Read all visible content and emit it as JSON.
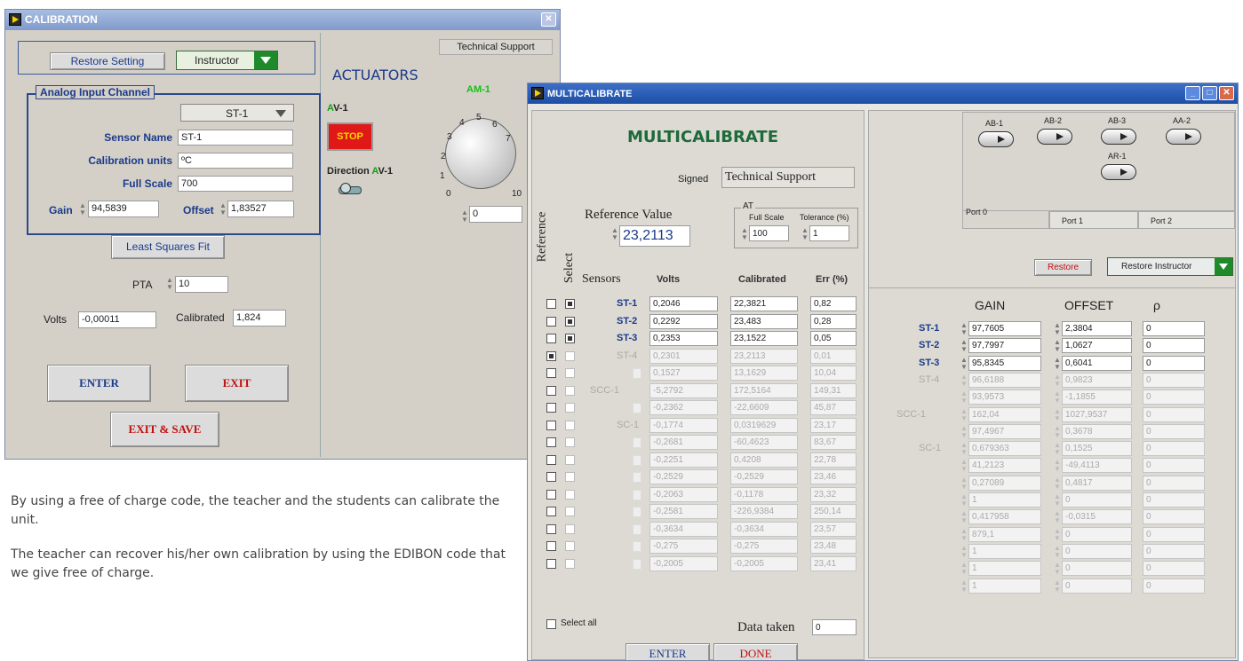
{
  "calibration": {
    "title": "CALIBRATION",
    "restore_setting": "Restore Setting",
    "user_select": "Instructor",
    "analog_group": "Analog Input Channel",
    "channel_select": "ST-1",
    "sensor_name_label": "Sensor Name",
    "sensor_name": "ST-1",
    "cal_units_label": "Calibration units",
    "cal_units": "ºC",
    "full_scale_label": "Full Scale",
    "full_scale": "700",
    "gain_label": "Gain",
    "gain": "94,5839",
    "offset_label": "Offset",
    "offset": "1,83527",
    "least_squares": "Least Squares Fit",
    "pta_label": "PTA",
    "pta": "10",
    "volts_label": "Volts",
    "volts": "-0,00011",
    "calibrated_label": "Calibrated",
    "calibrated": "1,824",
    "enter": "ENTER",
    "exit": "EXIT",
    "exit_save": "EXIT & SAVE",
    "tech_support": "Technical Support",
    "actuators": "ACTUATORS",
    "av_label_a": "A",
    "av_label_v": "V-1",
    "stop": "STOP",
    "direction_label": "Direction ",
    "direction_a": "A",
    "direction_v": "V-1",
    "am_label": "AM-1",
    "dial_ticks": [
      "0",
      "1",
      "2",
      "3",
      "4",
      "5",
      "6",
      "7",
      "10"
    ],
    "am_value": "0"
  },
  "description": {
    "p1": "By using a free of charge code, the teacher and the students can calibrate the unit.",
    "p2": "The teacher can recover his/her own calibration by using the EDIBON code that we give free of charge."
  },
  "multi": {
    "title": "MULTICALIBRATE",
    "heading": "MULTICALIBRATE",
    "signed_label": "Signed",
    "signed": "Technical Support",
    "reference_vert": "Reference",
    "select_vert": "Select",
    "ref_value_label": "Reference Value",
    "ref_value": "23,2113",
    "at_label": "AT",
    "full_scale_label": "Full Scale",
    "full_scale": "100",
    "tolerance_label": "Tolerance (%)",
    "tolerance": "1",
    "col_sensors": "Sensors",
    "col_volts": "Volts",
    "col_cal": "Calibrated",
    "col_err": "Err (%)",
    "rows": [
      {
        "ref": false,
        "sel": true,
        "name": "ST-1",
        "volts": "0,2046",
        "cal": "22,3821",
        "err": "0,82",
        "active": true
      },
      {
        "ref": false,
        "sel": true,
        "name": "ST-2",
        "volts": "0,2292",
        "cal": "23,483",
        "err": "0,28",
        "active": true
      },
      {
        "ref": false,
        "sel": true,
        "name": "ST-3",
        "volts": "0,2353",
        "cal": "23,1522",
        "err": "0,05",
        "active": true
      },
      {
        "ref": true,
        "sel": false,
        "name": "ST-4",
        "volts": "0,2301",
        "cal": "23,2113",
        "err": "0,01",
        "active": false
      },
      {
        "ref": false,
        "sel": false,
        "name": "",
        "volts": "0,1527",
        "cal": "13,1629",
        "err": "10,04",
        "active": false
      },
      {
        "ref": false,
        "sel": false,
        "name": "SCC-1",
        "volts": "-5,2792",
        "cal": "172,5164",
        "err": "149,31",
        "active": false
      },
      {
        "ref": false,
        "sel": false,
        "name": "",
        "volts": "-0,2362",
        "cal": "-22,6609",
        "err": "45,87",
        "active": false
      },
      {
        "ref": false,
        "sel": false,
        "name": "SC-1",
        "volts": "-0,1774",
        "cal": "0,0319629",
        "err": "23,17",
        "active": false
      },
      {
        "ref": false,
        "sel": false,
        "name": "",
        "volts": "-0,2681",
        "cal": "-60,4623",
        "err": "83,67",
        "active": false
      },
      {
        "ref": false,
        "sel": false,
        "name": "",
        "volts": "-0,2251",
        "cal": "0,4208",
        "err": "22,78",
        "active": false
      },
      {
        "ref": false,
        "sel": false,
        "name": "",
        "volts": "-0,2529",
        "cal": "-0,2529",
        "err": "23,46",
        "active": false
      },
      {
        "ref": false,
        "sel": false,
        "name": "",
        "volts": "-0,2063",
        "cal": "-0,1178",
        "err": "23,32",
        "active": false
      },
      {
        "ref": false,
        "sel": false,
        "name": "",
        "volts": "-0,2581",
        "cal": "-226,9384",
        "err": "250,14",
        "active": false
      },
      {
        "ref": false,
        "sel": false,
        "name": "",
        "volts": "-0,3634",
        "cal": "-0,3634",
        "err": "23,57",
        "active": false
      },
      {
        "ref": false,
        "sel": false,
        "name": "",
        "volts": "-0,275",
        "cal": "-0,275",
        "err": "23,48",
        "active": false
      },
      {
        "ref": false,
        "sel": false,
        "name": "",
        "volts": "-0,2005",
        "cal": "-0,2005",
        "err": "23,41",
        "active": false
      }
    ],
    "select_all": "Select all",
    "data_taken_label": "Data taken",
    "data_taken": "0",
    "enter": "ENTER",
    "done": "DONE",
    "ports": [
      "Port 0",
      "Port 1",
      "Port 2"
    ],
    "ab_toggles": [
      "AB-1",
      "AB-2",
      "AB-3",
      "AA-2",
      "AR-1"
    ],
    "restore": "Restore",
    "restore_instructor": "Restore Instructor",
    "col_gain": "GAIN",
    "col_offset": "OFFSET",
    "col_rho": "ρ",
    "grows": [
      {
        "name": "ST-1",
        "gain": "97,7605",
        "offset": "2,3804",
        "rho": "0",
        "active": true
      },
      {
        "name": "ST-2",
        "gain": "97,7997",
        "offset": "1,0627",
        "rho": "0",
        "active": true
      },
      {
        "name": "ST-3",
        "gain": "95,8345",
        "offset": "0,6041",
        "rho": "0",
        "active": true
      },
      {
        "name": "ST-4",
        "gain": "96,6188",
        "offset": "0,9823",
        "rho": "0",
        "active": false
      },
      {
        "name": "",
        "gain": "93,9573",
        "offset": "-1,1855",
        "rho": "0",
        "active": false
      },
      {
        "name": "SCC-1",
        "gain": "162,04",
        "offset": "1027,9537",
        "rho": "0",
        "active": false
      },
      {
        "name": "",
        "gain": "97,4967",
        "offset": "0,3678",
        "rho": "0",
        "active": false
      },
      {
        "name": "SC-1",
        "gain": "0,679363",
        "offset": "0,1525",
        "rho": "0",
        "active": false
      },
      {
        "name": "",
        "gain": "41,2123",
        "offset": "-49,4113",
        "rho": "0",
        "active": false
      },
      {
        "name": "",
        "gain": "0,27089",
        "offset": "0,4817",
        "rho": "0",
        "active": false
      },
      {
        "name": "",
        "gain": "1",
        "offset": "0",
        "rho": "0",
        "active": false
      },
      {
        "name": "",
        "gain": "0,417958",
        "offset": "-0,0315",
        "rho": "0",
        "active": false
      },
      {
        "name": "",
        "gain": "879,1",
        "offset": "0",
        "rho": "0",
        "active": false
      },
      {
        "name": "",
        "gain": "1",
        "offset": "0",
        "rho": "0",
        "active": false
      },
      {
        "name": "",
        "gain": "1",
        "offset": "0",
        "rho": "0",
        "active": false
      },
      {
        "name": "",
        "gain": "1",
        "offset": "0",
        "rho": "0",
        "active": false
      }
    ]
  }
}
